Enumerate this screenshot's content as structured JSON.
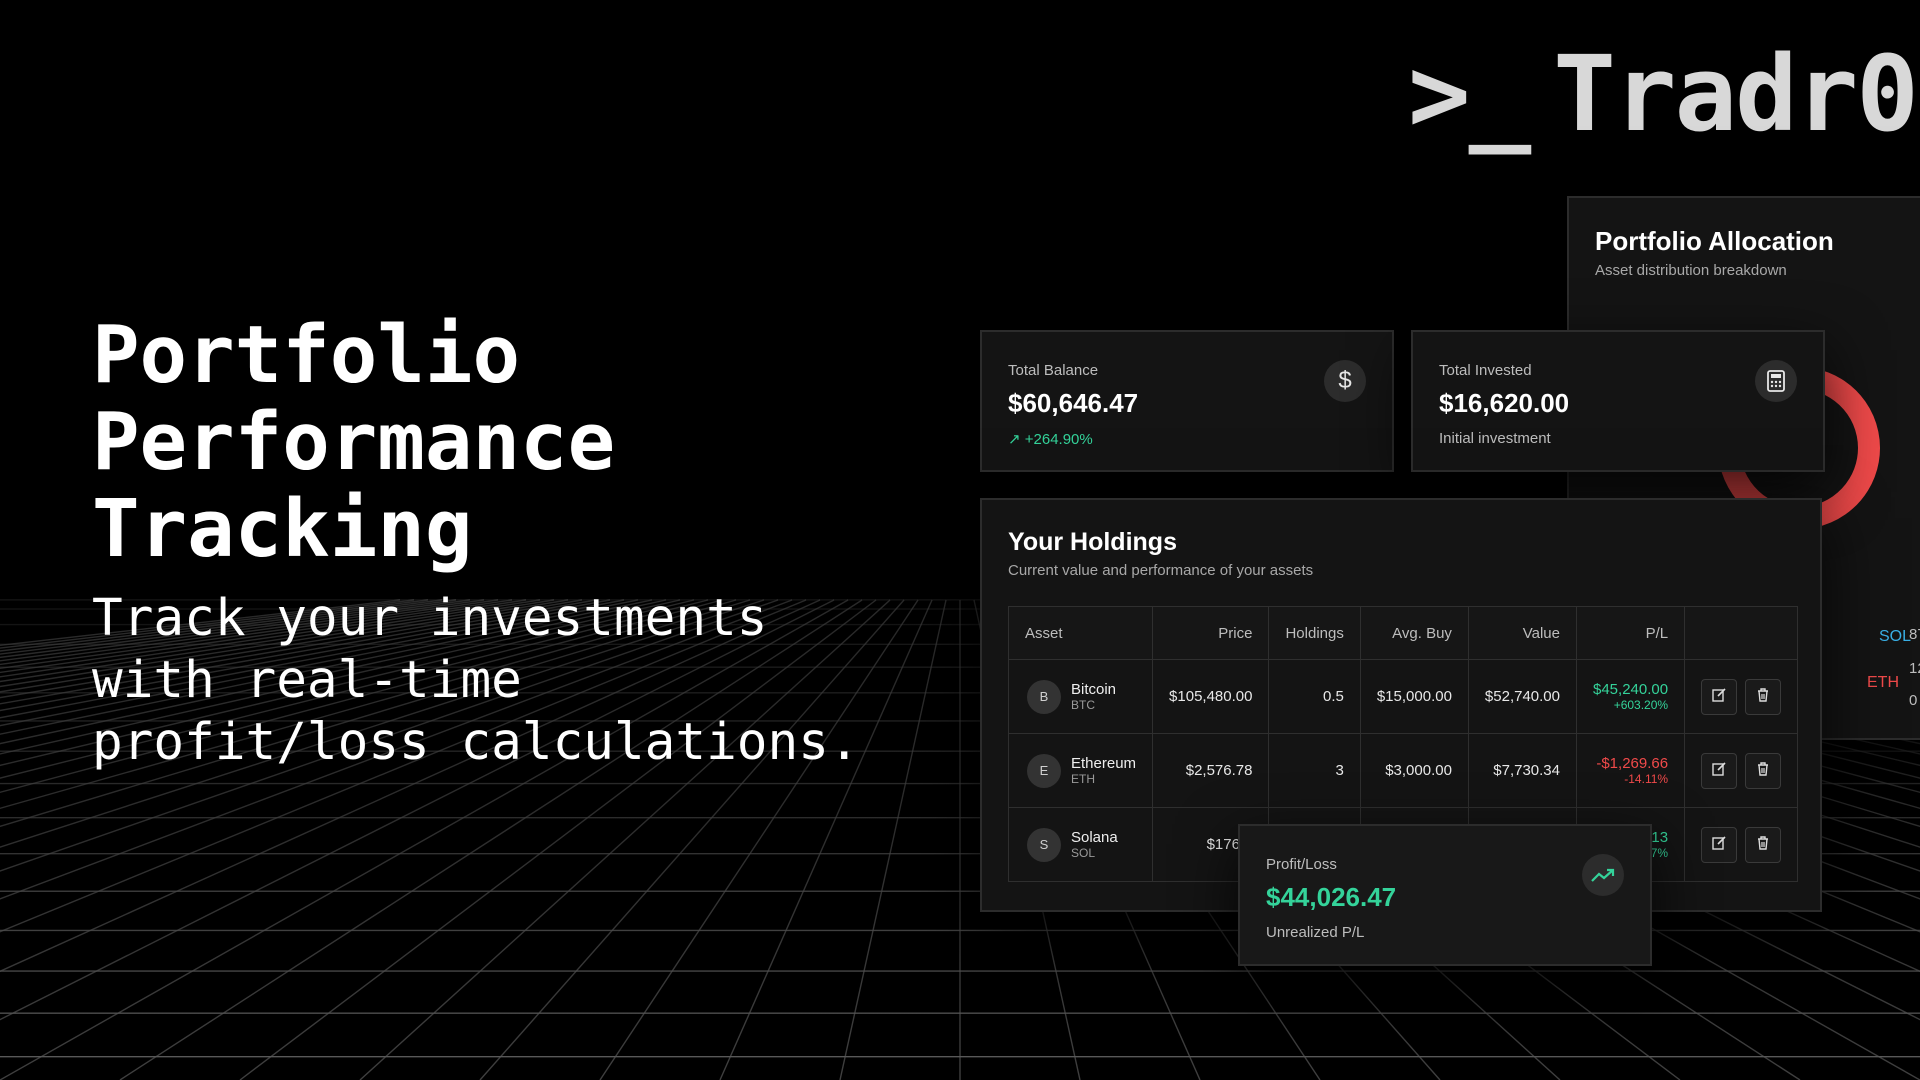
{
  "brand": {
    "prompt": ">_",
    "name": "Tradr0"
  },
  "hero": {
    "title_lines": [
      "Portfolio",
      "Performance",
      "Tracking"
    ],
    "subtitle_lines": [
      "Track your investments",
      "with real-time",
      "profit/loss calculations."
    ]
  },
  "allocation": {
    "title": "Portfolio Allocation",
    "subtitle": "Asset distribution breakdown",
    "labels": {
      "sol": "SOL",
      "eth": "ETH"
    },
    "side_values": [
      "87",
      "12",
      "0"
    ],
    "colors": {
      "btc": "#f04a4a",
      "sol": "#3ab0e6"
    }
  },
  "balance": {
    "label": "Total Balance",
    "value": "$60,646.47",
    "change": "+264.90%",
    "icon": "dollar-icon"
  },
  "invested": {
    "label": "Total Invested",
    "value": "$16,620.00",
    "note": "Initial investment",
    "icon": "calculator-icon"
  },
  "holdings": {
    "title": "Your Holdings",
    "subtitle": "Current value and performance of your assets",
    "columns": [
      "Asset",
      "Price",
      "Holdings",
      "Avg. Buy",
      "Value",
      "P/L",
      ""
    ],
    "rows": [
      {
        "initial": "B",
        "name": "Bitcoin",
        "symbol": "BTC",
        "price": "$105,480.00",
        "holdings": "0.5",
        "avg_buy": "$15,000.00",
        "value": "$52,740.00",
        "pl": "$45,240.00",
        "pl_pct": "+603.20%",
        "positive": true
      },
      {
        "initial": "E",
        "name": "Ethereum",
        "symbol": "ETH",
        "price": "$2,576.78",
        "holdings": "3",
        "avg_buy": "$3,000.00",
        "value": "$7,730.34",
        "pl": "-$1,269.66",
        "pl_pct": "-14.11%",
        "positive": false
      },
      {
        "initial": "S",
        "name": "Solana",
        "symbol": "SOL",
        "price": "$176.1",
        "holdings": "",
        "avg_buy": "",
        "value": "",
        "pl": "13",
        "pl_pct": "7%",
        "positive": true
      }
    ]
  },
  "profit_loss": {
    "label": "Profit/Loss",
    "value": "$44,026.47",
    "note": "Unrealized P/L",
    "icon": "trending-up-icon"
  },
  "colors": {
    "positive": "#34d39a",
    "negative": "#f04a4a",
    "accent_blue": "#3ab0e6"
  }
}
